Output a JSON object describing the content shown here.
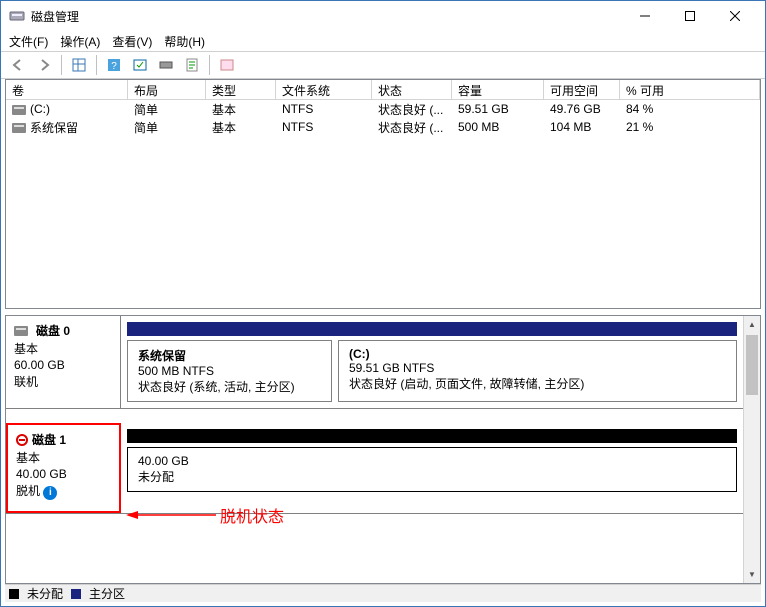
{
  "window": {
    "title": "磁盘管理"
  },
  "menu": {
    "file": "文件(F)",
    "action": "操作(A)",
    "view": "查看(V)",
    "help": "帮助(H)"
  },
  "table": {
    "headers": {
      "volume": "卷",
      "layout": "布局",
      "type": "类型",
      "fs": "文件系统",
      "status": "状态",
      "capacity": "容量",
      "free": "可用空间",
      "percent": "% 可用"
    },
    "rows": [
      {
        "volume": "(C:)",
        "layout": "简单",
        "type": "基本",
        "fs": "NTFS",
        "status": "状态良好 (...",
        "capacity": "59.51 GB",
        "free": "49.76 GB",
        "percent": "84 %"
      },
      {
        "volume": "系统保留",
        "layout": "简单",
        "type": "基本",
        "fs": "NTFS",
        "status": "状态良好 (...",
        "capacity": "500 MB",
        "free": "104 MB",
        "percent": "21 %"
      }
    ]
  },
  "disks": {
    "disk0": {
      "name": "磁盘 0",
      "type": "基本",
      "size": "60.00 GB",
      "state": "联机",
      "partitions": [
        {
          "title": "系统保留",
          "line2": "500 MB NTFS",
          "line3": "状态良好 (系统, 活动, 主分区)"
        },
        {
          "title": "(C:)",
          "line2": "59.51 GB NTFS",
          "line3": "状态良好 (启动, 页面文件, 故障转储, 主分区)"
        }
      ]
    },
    "disk1": {
      "name": "磁盘 1",
      "type": "基本",
      "size": "40.00 GB",
      "state": "脱机",
      "partitions": [
        {
          "line1": "40.00 GB",
          "line2": "未分配"
        }
      ]
    }
  },
  "legend": {
    "unallocated": "未分配",
    "primary": "主分区"
  },
  "annotation": {
    "text": "脱机状态"
  }
}
